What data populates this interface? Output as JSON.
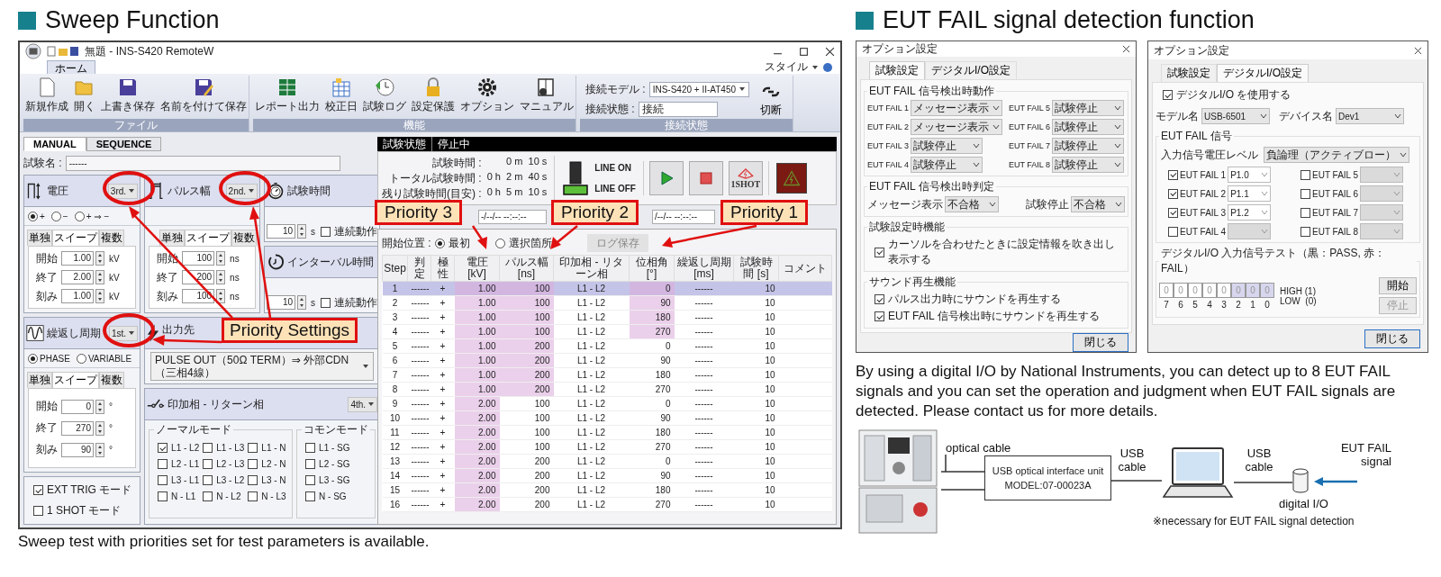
{
  "sweep": {
    "heading": "Sweep Function",
    "window": {
      "title": "無題 - INS-S420 RemoteW",
      "ribbon_tab": "ホーム",
      "style_menu": "スタイル"
    },
    "ribbon_groups": [
      {
        "label": "ファイル",
        "buttons": [
          {
            "kind": "new",
            "label": "新規作成"
          },
          {
            "kind": "open",
            "label": "開く"
          },
          {
            "kind": "save",
            "label": "上書き保存"
          },
          {
            "kind": "saveas",
            "label": "名前を付けて保存"
          }
        ]
      },
      {
        "label": "機能",
        "buttons": [
          {
            "kind": "excel",
            "label": "レポート出力"
          },
          {
            "kind": "calendar",
            "label": "校正日"
          },
          {
            "kind": "log",
            "label": "試験ログ"
          },
          {
            "kind": "lock",
            "label": "設定保護"
          },
          {
            "kind": "gear",
            "label": "オプション"
          },
          {
            "kind": "manual",
            "label": "マニュアル"
          }
        ]
      }
    ],
    "connection": {
      "group_label": "接続状態",
      "model_label": "接続モデル :",
      "model": "INS-S420 + II-AT450",
      "state_label": "接続状態 :",
      "state": "接続",
      "disconnect": "切断"
    },
    "mode_tabs": [
      {
        "label": "MANUAL",
        "selected": true
      },
      {
        "label": "SEQUENCE",
        "selected": false
      }
    ],
    "test_name": {
      "label": "試験名 :",
      "value": "------"
    },
    "voltage": {
      "title": "電圧",
      "priority": "3rd.",
      "polarities": [
        {
          "label": "+",
          "selected": true
        },
        {
          "label": "−",
          "selected": false
        },
        {
          "label": "+ ⇒ −",
          "selected": false
        }
      ],
      "subtabs": [
        {
          "label": "単独",
          "selected": false
        },
        {
          "label": "スイープ",
          "selected": true
        },
        {
          "label": "複数",
          "selected": false
        }
      ],
      "fields": [
        {
          "label": "開始",
          "value": "1.00",
          "unit": "kV"
        },
        {
          "label": "終了",
          "value": "2.00",
          "unit": "kV"
        },
        {
          "label": "刻み",
          "value": "1.00",
          "unit": "kV"
        }
      ]
    },
    "pulse_width": {
      "title": "パルス幅",
      "priority": "2nd.",
      "subtabs": [
        {
          "label": "単独",
          "selected": false
        },
        {
          "label": "スイープ",
          "selected": true
        },
        {
          "label": "複数",
          "selected": false
        }
      ],
      "fields": [
        {
          "label": "開始",
          "value": "100",
          "unit": "ns"
        },
        {
          "label": "終了",
          "value": "200",
          "unit": "ns"
        },
        {
          "label": "刻み",
          "value": "100",
          "unit": "ns"
        }
      ]
    },
    "test_time": {
      "title": "試験時間",
      "value": "10",
      "unit": "s",
      "continuous": {
        "label": "連続動作",
        "checked": false
      }
    },
    "interval": {
      "title": "インターバル時間",
      "value": "10",
      "unit": "s",
      "continuous": {
        "label": "連続動作",
        "checked": false
      }
    },
    "period": {
      "title": "繰返し周期",
      "priority": "1st.",
      "modes": [
        {
          "label": "PHASE",
          "selected": true
        },
        {
          "label": "VARIABLE",
          "selected": false
        }
      ],
      "subtabs": [
        {
          "label": "単独",
          "selected": false
        },
        {
          "label": "スイープ",
          "selected": true
        },
        {
          "label": "複数",
          "selected": false
        }
      ],
      "fields": [
        {
          "label": "開始",
          "value": "0",
          "unit": "°"
        },
        {
          "label": "終了",
          "value": "270",
          "unit": "°"
        },
        {
          "label": "刻み",
          "value": "90",
          "unit": "°"
        }
      ]
    },
    "trigger_options": [
      {
        "label": "EXT TRIG モード",
        "checked": true
      },
      {
        "label": "1 SHOT モード",
        "checked": false
      }
    ],
    "output": {
      "title": "出力先",
      "value": "PULSE OUT（50Ω TERM）⇒ 外部CDN（三相4線）"
    },
    "phase": {
      "title": "印加相 - リターン相",
      "priority": "4th.",
      "normal": {
        "label": "ノーマルモード",
        "options": [
          {
            "label": "L1 - L2",
            "checked": true
          },
          {
            "label": "L1 - L3",
            "checked": false
          },
          {
            "label": "L1 - N",
            "checked": false
          },
          {
            "label": "L2 - L1",
            "checked": false
          },
          {
            "label": "L2 - L3",
            "checked": false
          },
          {
            "label": "L2 - N",
            "checked": false
          },
          {
            "label": "L3 - L1",
            "checked": false
          },
          {
            "label": "L3 - L2",
            "checked": false
          },
          {
            "label": "L3 - N",
            "checked": false
          },
          {
            "label": "N - L1",
            "checked": false
          },
          {
            "label": "N - L2",
            "checked": false
          },
          {
            "label": "N - L3",
            "checked": false
          }
        ]
      },
      "common": {
        "label": "コモンモード",
        "options": [
          {
            "label": "L1 - SG",
            "checked": false
          },
          {
            "label": "L2 - SG",
            "checked": false
          },
          {
            "label": "L3 - SG",
            "checked": false
          },
          {
            "label": "N - SG",
            "checked": false
          }
        ]
      }
    },
    "status": {
      "label": "試験状態",
      "value": "停止中"
    },
    "timers": [
      {
        "label": "試験時間 :",
        "value": "0 m  10 s"
      },
      {
        "label": "トータル試験時間 :",
        "value": "0 h  2 m  40 s"
      },
      {
        "label": "残り試験時間(目安) :",
        "value": "0 h  5 m  10 s"
      }
    ],
    "line": {
      "on_label": "LINE ON",
      "off_label": "LINE OFF",
      "on": false
    },
    "shot_button": "1SHOT",
    "date_fields": [
      "-/--/-- --:--:--",
      "/--/-- --:--:--"
    ],
    "start_position": {
      "label": "開始位置 :",
      "options": [
        {
          "label": "最初",
          "selected": true
        },
        {
          "label": "選択箇所",
          "selected": false
        }
      ],
      "log_button": "ログ保存"
    },
    "table": {
      "columns": [
        "Step",
        "判定",
        "極性",
        "電圧 [kV]",
        "パルス幅 [ns]",
        "印加相 - リターン相",
        "位相角 [°]",
        "繰返し周期 [ms]",
        "試験時間 [s]",
        "コメント"
      ],
      "rows": [
        {
          "step": "1",
          "judgment": "------",
          "polarity": "+",
          "kv": "1.00",
          "ns": "100",
          "phases": "L1 - L2",
          "angle": "0",
          "period": "------",
          "time": "10",
          "selected": true,
          "kv_highlight": true,
          "ns_highlight": true,
          "angle_highlight": true
        },
        {
          "step": "2",
          "judgment": "------",
          "polarity": "+",
          "kv": "1.00",
          "ns": "100",
          "phases": "L1 - L2",
          "angle": "90",
          "period": "------",
          "time": "10",
          "selected": false,
          "kv_highlight": true,
          "ns_highlight": true,
          "angle_highlight": true
        },
        {
          "step": "3",
          "judgment": "------",
          "polarity": "+",
          "kv": "1.00",
          "ns": "100",
          "phases": "L1 - L2",
          "angle": "180",
          "period": "------",
          "time": "10",
          "selected": false,
          "kv_highlight": true,
          "ns_highlight": true,
          "angle_highlight": true
        },
        {
          "step": "4",
          "judgment": "------",
          "polarity": "+",
          "kv": "1.00",
          "ns": "100",
          "phases": "L1 - L2",
          "angle": "270",
          "period": "------",
          "time": "10",
          "selected": false,
          "kv_highlight": true,
          "ns_highlight": true,
          "angle_highlight": true
        },
        {
          "step": "5",
          "judgment": "------",
          "polarity": "+",
          "kv": "1.00",
          "ns": "200",
          "phases": "L1 - L2",
          "angle": "0",
          "period": "------",
          "time": "10",
          "selected": false,
          "kv_highlight": true,
          "ns_highlight": true,
          "angle_highlight": false
        },
        {
          "step": "6",
          "judgment": "------",
          "polarity": "+",
          "kv": "1.00",
          "ns": "200",
          "phases": "L1 - L2",
          "angle": "90",
          "period": "------",
          "time": "10",
          "selected": false,
          "kv_highlight": true,
          "ns_highlight": true,
          "angle_highlight": false
        },
        {
          "step": "7",
          "judgment": "------",
          "polarity": "+",
          "kv": "1.00",
          "ns": "200",
          "phases": "L1 - L2",
          "angle": "180",
          "period": "------",
          "time": "10",
          "selected": false,
          "kv_highlight": true,
          "ns_highlight": true,
          "angle_highlight": false
        },
        {
          "step": "8",
          "judgment": "------",
          "polarity": "+",
          "kv": "1.00",
          "ns": "200",
          "phases": "L1 - L2",
          "angle": "270",
          "period": "------",
          "time": "10",
          "selected": false,
          "kv_highlight": true,
          "ns_highlight": true,
          "angle_highlight": false
        },
        {
          "step": "9",
          "judgment": "------",
          "polarity": "+",
          "kv": "2.00",
          "ns": "100",
          "phases": "L1 - L2",
          "angle": "0",
          "period": "------",
          "time": "10",
          "selected": false,
          "kv_highlight": true,
          "ns_highlight": false,
          "angle_highlight": false
        },
        {
          "step": "10",
          "judgment": "------",
          "polarity": "+",
          "kv": "2.00",
          "ns": "100",
          "phases": "L1 - L2",
          "angle": "90",
          "period": "------",
          "time": "10",
          "selected": false,
          "kv_highlight": true,
          "ns_highlight": false,
          "angle_highlight": false
        },
        {
          "step": "11",
          "judgment": "------",
          "polarity": "+",
          "kv": "2.00",
          "ns": "100",
          "phases": "L1 - L2",
          "angle": "180",
          "period": "------",
          "time": "10",
          "selected": false,
          "kv_highlight": true,
          "ns_highlight": false,
          "angle_highlight": false
        },
        {
          "step": "12",
          "judgment": "------",
          "polarity": "+",
          "kv": "2.00",
          "ns": "100",
          "phases": "L1 - L2",
          "angle": "270",
          "period": "------",
          "time": "10",
          "selected": false,
          "kv_highlight": true,
          "ns_highlight": false,
          "angle_highlight": false
        },
        {
          "step": "13",
          "judgment": "------",
          "polarity": "+",
          "kv": "2.00",
          "ns": "200",
          "phases": "L1 - L2",
          "angle": "0",
          "period": "------",
          "time": "10",
          "selected": false,
          "kv_highlight": true,
          "ns_highlight": false,
          "angle_highlight": false
        },
        {
          "step": "14",
          "judgment": "------",
          "polarity": "+",
          "kv": "2.00",
          "ns": "200",
          "phases": "L1 - L2",
          "angle": "90",
          "period": "------",
          "time": "10",
          "selected": false,
          "kv_highlight": true,
          "ns_highlight": false,
          "angle_highlight": false
        },
        {
          "step": "15",
          "judgment": "------",
          "polarity": "+",
          "kv": "2.00",
          "ns": "200",
          "phases": "L1 - L2",
          "angle": "180",
          "period": "------",
          "time": "10",
          "selected": false,
          "kv_highlight": true,
          "ns_highlight": false,
          "angle_highlight": false
        },
        {
          "step": "16",
          "judgment": "------",
          "polarity": "+",
          "kv": "2.00",
          "ns": "200",
          "phases": "L1 - L2",
          "angle": "270",
          "period": "------",
          "time": "10",
          "selected": false,
          "kv_highlight": true,
          "ns_highlight": false,
          "angle_highlight": false
        }
      ]
    },
    "callouts": [
      "Priority 3",
      "Priority 2",
      "Priority 1",
      "Priority Settings"
    ],
    "caption": "Sweep test with priorities set for test parameters is available."
  },
  "eut": {
    "heading": "EUT FAIL signal detection function",
    "test_dialog": {
      "title": "オプション設定",
      "tabs": [
        {
          "label": "試験設定",
          "selected": true
        },
        {
          "label": "デジタルI/O設定",
          "selected": false
        }
      ],
      "action_group": {
        "label": "EUT FAIL 信号検出時動作",
        "items": [
          {
            "label": "EUT FAIL 1",
            "value": "メッセージ表示"
          },
          {
            "label": "EUT FAIL 2",
            "value": "メッセージ表示"
          },
          {
            "label": "EUT FAIL 3",
            "value": "試験停止"
          },
          {
            "label": "EUT FAIL 4",
            "value": "試験停止"
          },
          {
            "label": "EUT FAIL 5",
            "value": "試験停止"
          },
          {
            "label": "EUT FAIL 6",
            "value": "試験停止"
          },
          {
            "label": "EUT FAIL 7",
            "value": "試験停止"
          },
          {
            "label": "EUT FAIL 8",
            "value": "試験停止"
          }
        ]
      },
      "judge_group": {
        "label": "EUT FAIL 信号検出時判定",
        "items": [
          {
            "label": "メッセージ表示",
            "value": "不合格"
          },
          {
            "label": "試験停止",
            "value": "不合格"
          }
        ]
      },
      "setting_group": {
        "label": "試験設定時機能",
        "options": [
          {
            "label": "カーソルを合わせたときに設定情報を吹き出し表示する",
            "checked": true
          }
        ]
      },
      "sound_group": {
        "label": "サウンド再生機能",
        "options": [
          {
            "label": "パルス出力時にサウンドを再生する",
            "checked": true
          },
          {
            "label": "EUT FAIL 信号検出時にサウンドを再生する",
            "checked": true
          }
        ]
      },
      "close": "閉じる"
    },
    "dio_dialog": {
      "title": "オプション設定",
      "tabs": [
        {
          "label": "試験設定",
          "selected": false
        },
        {
          "label": "デジタルI/O設定",
          "selected": true
        }
      ],
      "use_dio": {
        "label": "デジタルI/O を使用する",
        "checked": true
      },
      "model": {
        "label": "モデル名",
        "value": "USB-6501"
      },
      "device": {
        "label": "デバイス名",
        "value": "Dev1"
      },
      "signal_group": {
        "label": "EUT FAIL 信号",
        "level_label": "入力信号電圧レベル",
        "level_value": "負論理（アクティブロー）",
        "items": [
          {
            "label": "EUT FAIL 1",
            "checked": true,
            "port": "P1.0"
          },
          {
            "label": "EUT FAIL 2",
            "checked": true,
            "port": "P1.1"
          },
          {
            "label": "EUT FAIL 3",
            "checked": true,
            "port": "P1.2"
          },
          {
            "label": "EUT FAIL 4",
            "checked": false
          },
          {
            "label": "EUT FAIL 5",
            "checked": false
          },
          {
            "label": "EUT FAIL 6",
            "checked": false
          },
          {
            "label": "EUT FAIL 7",
            "checked": false
          },
          {
            "label": "EUT FAIL 8",
            "checked": false
          }
        ]
      },
      "test_group": {
        "label": "デジタルI/O 入力信号テスト（黒：PASS, 赤：FAIL）",
        "bits": [
          {
            "value": "0",
            "number": "7",
            "active": false
          },
          {
            "value": "0",
            "number": "6",
            "active": false
          },
          {
            "value": "0",
            "number": "5",
            "active": false
          },
          {
            "value": "0",
            "number": "4",
            "active": false
          },
          {
            "value": "0",
            "number": "3",
            "active": false
          },
          {
            "value": "0",
            "number": "2",
            "active": true
          },
          {
            "value": "0",
            "number": "1",
            "active": true
          },
          {
            "value": "0",
            "number": "0",
            "active": true
          }
        ],
        "high": "HIGH (1)",
        "low": "LOW  (0)",
        "start": "開始",
        "stop": "停止"
      },
      "close": "閉じる"
    },
    "description": "By using a digital I/O by National Instruments, you can detect up to 8 EUT FAIL signals and you can set the operation and judgment when EUT FAIL signals are detected. Please contact us for more details.",
    "diagram": {
      "optical_cable": "optical cable",
      "unit_name": "USB optical interface unit",
      "unit_model": "MODEL:07-00023A",
      "usb_cable_left": "USB cable",
      "usb_cable_right": "USB cable",
      "signal": "EUT FAIL signal",
      "dio": "digital I/O",
      "note": "※necessary for EUT FAIL signal detection"
    }
  }
}
